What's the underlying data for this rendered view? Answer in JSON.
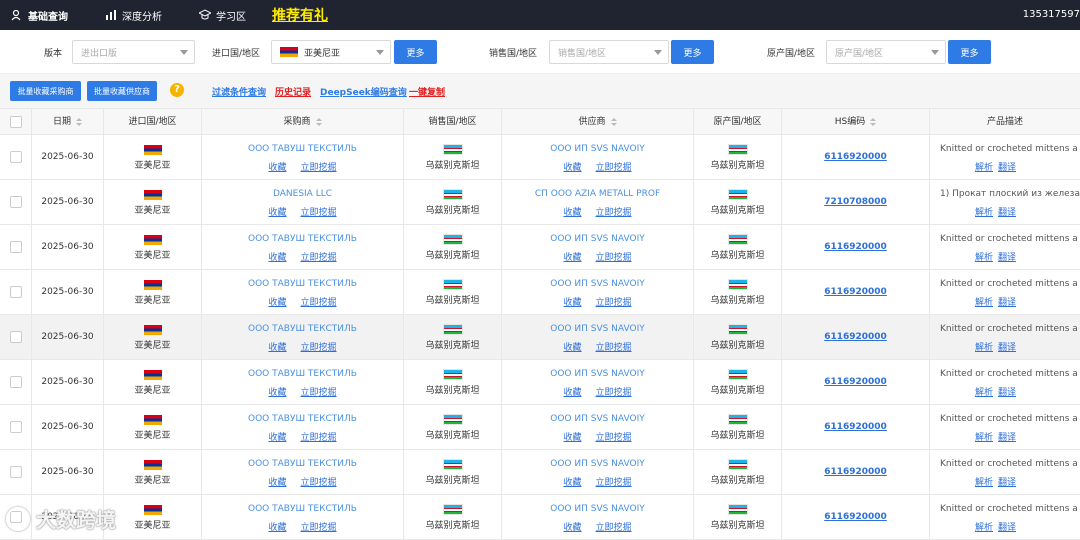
{
  "topbar": {
    "nav": [
      {
        "label": "基础查询",
        "icon": "search-people-icon"
      },
      {
        "label": "深度分析",
        "icon": "analysis-icon"
      },
      {
        "label": "学习区",
        "icon": "graduation-cap-icon"
      }
    ],
    "promo": "推荐有礼",
    "phone": "135317597"
  },
  "filters": {
    "version_label": "版本",
    "version_placeholder": "进出口版",
    "import_label": "进口国/地区",
    "import_value": "亚美尼亚",
    "sale_label": "销售国/地区",
    "sale_placeholder": "销售国/地区",
    "origin_label": "原产国/地区",
    "origin_placeholder": "原产国/地区",
    "more_label": "更多"
  },
  "toolbar": {
    "collect_buyer": "批量收藏采购商",
    "collect_supplier": "批量收藏供应商",
    "help": "?",
    "links": [
      {
        "label": "过滤条件查询",
        "color": "#2e7be6"
      },
      {
        "label": "历史记录",
        "color": "#e02020"
      },
      {
        "label": "DeepSeek编码查询",
        "color": "#2e7be6"
      },
      {
        "label": "一键复制",
        "color": "#e02020"
      }
    ]
  },
  "table": {
    "headers": {
      "date": "日期",
      "import": "进口国/地区",
      "buyer": "采购商",
      "sale": "销售国/地区",
      "supplier": "供应商",
      "origin": "原产国/地区",
      "hs": "HS编码",
      "desc": "产品描述"
    },
    "actions": {
      "collect": "收藏",
      "mine": "立即挖掘",
      "parse": "解析",
      "translate": "翻译"
    },
    "rows": [
      {
        "date": "2025-06-30",
        "import": "亚美尼亚",
        "buyer": "ООО ТАВУШ ТЕКСТИЛЬ",
        "sale": "乌兹别克斯坦",
        "supplier": "ООО ИП SVS NAVOIY",
        "origin": "乌兹别克斯坦",
        "hs": "6116920000",
        "desc": "Knitted or crocheted mittens a"
      },
      {
        "date": "2025-06-30",
        "import": "亚美尼亚",
        "buyer": "DANESIA LLC",
        "sale": "乌兹别克斯坦",
        "supplier": "СП ООО AZIA METALL PROF",
        "origin": "乌兹别克斯坦",
        "hs": "7210708000",
        "desc": "1) Прокат плоский из железа"
      },
      {
        "date": "2025-06-30",
        "import": "亚美尼亚",
        "buyer": "ООО ТАВУШ ТЕКСТИЛЬ",
        "sale": "乌兹别克斯坦",
        "supplier": "ООО ИП SVS NAVOIY",
        "origin": "乌兹别克斯坦",
        "hs": "6116920000",
        "desc": "Knitted or crocheted mittens a"
      },
      {
        "date": "2025-06-30",
        "import": "亚美尼亚",
        "buyer": "ООО ТАВУШ ТЕКСТИЛЬ",
        "sale": "乌兹别克斯坦",
        "supplier": "ООО ИП SVS NAVOIY",
        "origin": "乌兹别克斯坦",
        "hs": "6116920000",
        "desc": "Knitted or crocheted mittens a"
      },
      {
        "date": "2025-06-30",
        "import": "亚美尼亚",
        "buyer": "ООО ТАВУШ ТЕКСТИЛЬ",
        "sale": "乌兹别克斯坦",
        "supplier": "ООО ИП SVS NAVOIY",
        "origin": "乌兹别克斯坦",
        "hs": "6116920000",
        "desc": "Knitted or crocheted mittens a",
        "highlight": true
      },
      {
        "date": "2025-06-30",
        "import": "亚美尼亚",
        "buyer": "ООО ТАВУШ ТЕКСТИЛЬ",
        "sale": "乌兹别克斯坦",
        "supplier": "ООО ИП SVS NAVOIY",
        "origin": "乌兹别克斯坦",
        "hs": "6116920000",
        "desc": "Knitted or crocheted mittens a"
      },
      {
        "date": "2025-06-30",
        "import": "亚美尼亚",
        "buyer": "ООО ТАВУШ ТЕКСТИЛЬ",
        "sale": "乌兹别克斯坦",
        "supplier": "ООО ИП SVS NAVOIY",
        "origin": "乌兹别克斯坦",
        "hs": "6116920000",
        "desc": "Knitted or crocheted mittens a"
      },
      {
        "date": "2025-06-30",
        "import": "亚美尼亚",
        "buyer": "ООО ТАВУШ ТЕКСТИЛЬ",
        "sale": "乌兹别克斯坦",
        "supplier": "ООО ИП SVS NAVOIY",
        "origin": "乌兹别克斯坦",
        "hs": "6116920000",
        "desc": "Knitted or crocheted mittens a"
      },
      {
        "date": "2025-06-30",
        "import": "亚美尼亚",
        "buyer": "ООО ТАВУШ ТЕКСТИЛЬ",
        "sale": "乌兹别克斯坦",
        "supplier": "ООО ИП SVS NAVOIY",
        "origin": "乌兹别克斯坦",
        "hs": "6116920000",
        "desc": "Knitted or crocheted mittens a"
      }
    ]
  },
  "watermark": "大数跨境"
}
